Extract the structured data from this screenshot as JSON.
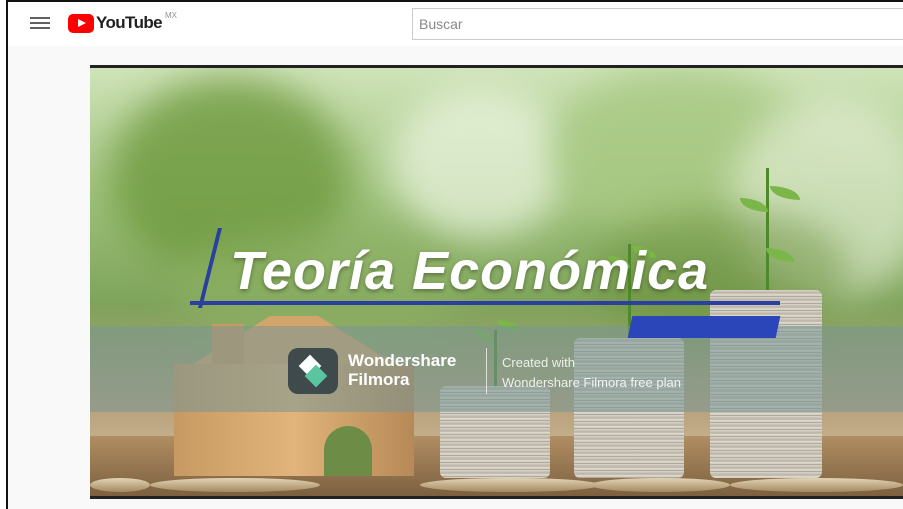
{
  "header": {
    "logo_text": "YouTube",
    "country_code": "MX",
    "search_placeholder": "Buscar"
  },
  "video": {
    "title": "Teoría Económica",
    "watermark": {
      "brand_line1": "Wondershare",
      "brand_line2": "Filmora",
      "note_line1": "Created with",
      "note_line2": "Wondershare Filmora free plan"
    }
  },
  "colors": {
    "youtube_red": "#ff0000",
    "title_accent": "#2b46b8"
  }
}
